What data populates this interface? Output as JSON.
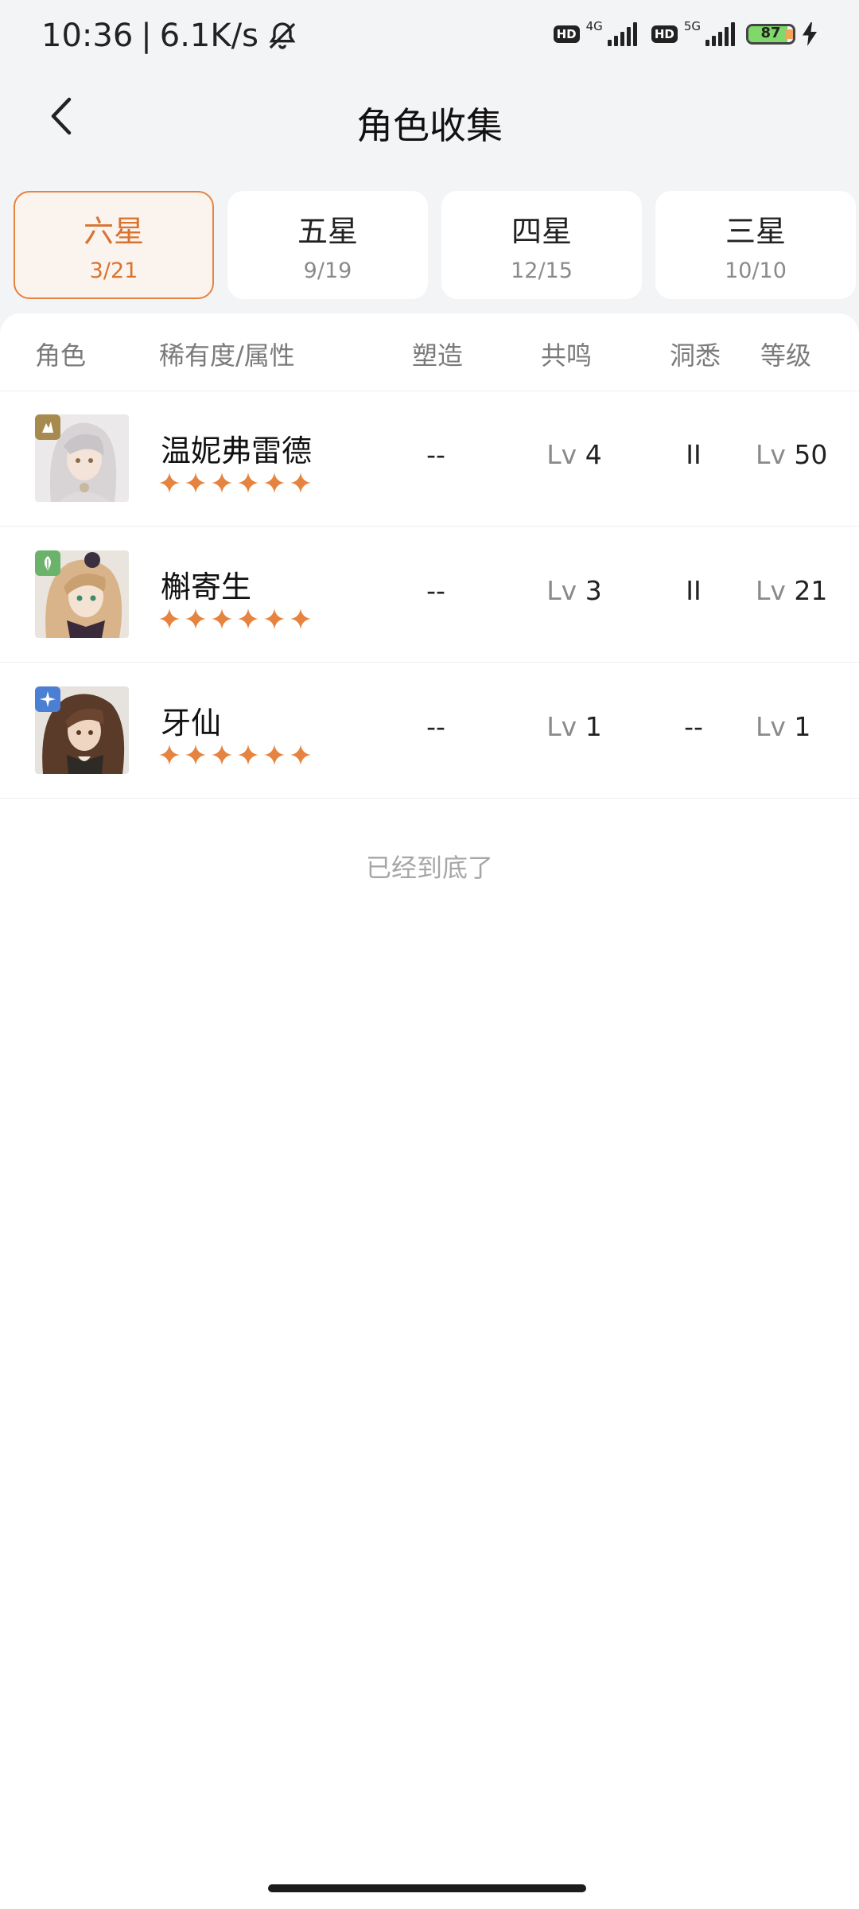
{
  "status_bar": {
    "time": "10:36",
    "net_speed": "6.1K/s",
    "sim1_badge": "HD",
    "sim1_network": "4G",
    "sim2_badge": "HD",
    "sim2_network": "5G",
    "battery_level": "87"
  },
  "header": {
    "title": "角色收集"
  },
  "tabs": [
    {
      "name": "六星",
      "count": "3/21",
      "active": true
    },
    {
      "name": "五星",
      "count": "9/19",
      "active": false
    },
    {
      "name": "四星",
      "count": "12/15",
      "active": false
    },
    {
      "name": "三星",
      "count": "10/10",
      "active": false
    }
  ],
  "columns": {
    "character": "角色",
    "rarity_attr": "稀有度/属性",
    "forge": "塑造",
    "resonance": "共鸣",
    "insight": "洞悉",
    "level": "等级"
  },
  "lv_prefix": "Lv",
  "characters": [
    {
      "name": "温妮弗雷德",
      "stars": 6,
      "forge": "--",
      "resonance": "4",
      "insight": "II",
      "level": "50",
      "element_icon": "beast-icon",
      "element_color": "#a68a4e"
    },
    {
      "name": "槲寄生",
      "stars": 6,
      "forge": "--",
      "resonance": "3",
      "insight": "II",
      "level": "21",
      "element_icon": "leaf-icon",
      "element_color": "#6bb36a"
    },
    {
      "name": "牙仙",
      "stars": 6,
      "forge": "--",
      "resonance": "1",
      "insight": "--",
      "level": "1",
      "element_icon": "star-compass-icon",
      "element_color": "#4a7fd4"
    }
  ],
  "footer_text": "已经到底了",
  "colors": {
    "accent": "#e6833f",
    "star": "#e6833f"
  }
}
